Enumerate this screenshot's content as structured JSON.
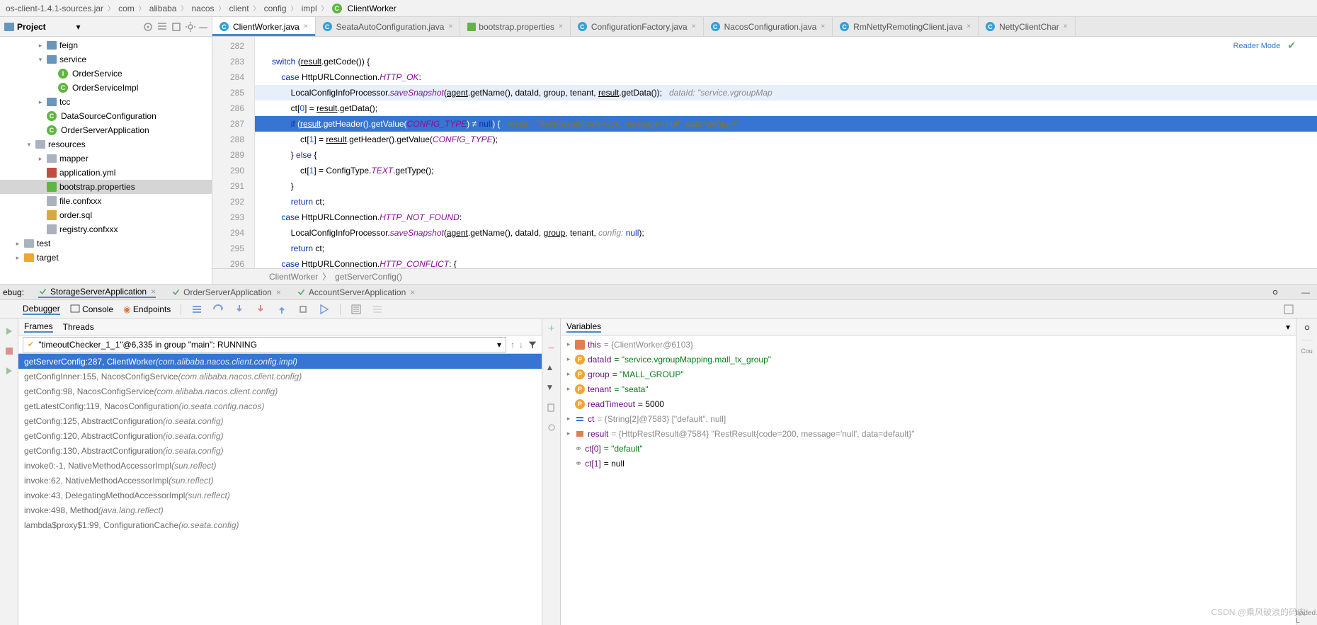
{
  "breadcrumb": [
    "os-client-1.4.1-sources.jar",
    "com",
    "alibaba",
    "nacos",
    "client",
    "config",
    "impl",
    "ClientWorker"
  ],
  "project": {
    "label": "Project",
    "tree": [
      {
        "indent": 3,
        "arrow": ">",
        "icon": "folder-blue",
        "label": "feign"
      },
      {
        "indent": 3,
        "arrow": "v",
        "icon": "folder-blue",
        "label": "service"
      },
      {
        "indent": 4,
        "arrow": "",
        "icon": "interface",
        "label": "OrderService"
      },
      {
        "indent": 4,
        "arrow": "",
        "icon": "class",
        "label": "OrderServiceImpl"
      },
      {
        "indent": 3,
        "arrow": ">",
        "icon": "folder-blue",
        "label": "tcc"
      },
      {
        "indent": 3,
        "arrow": "",
        "icon": "class",
        "label": "DataSourceConfiguration"
      },
      {
        "indent": 3,
        "arrow": "",
        "icon": "class",
        "label": "OrderServerApplication"
      },
      {
        "indent": 2,
        "arrow": "v",
        "icon": "folder-res",
        "label": "resources"
      },
      {
        "indent": 3,
        "arrow": ">",
        "icon": "folder",
        "label": "mapper"
      },
      {
        "indent": 3,
        "arrow": "",
        "icon": "yml",
        "label": "application.yml"
      },
      {
        "indent": 3,
        "arrow": "",
        "icon": "prop",
        "label": "bootstrap.properties",
        "sel": true
      },
      {
        "indent": 3,
        "arrow": "",
        "icon": "txt",
        "label": "file.confxxx"
      },
      {
        "indent": 3,
        "arrow": "",
        "icon": "sql",
        "label": "order.sql"
      },
      {
        "indent": 3,
        "arrow": "",
        "icon": "txt",
        "label": "registry.confxxx"
      },
      {
        "indent": 1,
        "arrow": ">",
        "icon": "folder",
        "label": "test"
      },
      {
        "indent": 1,
        "arrow": ">",
        "icon": "folder-orange",
        "label": "target"
      }
    ]
  },
  "editor": {
    "tabs": [
      {
        "label": "ClientWorker.java",
        "active": true
      },
      {
        "label": "SeataAutoConfiguration.java"
      },
      {
        "label": "bootstrap.properties",
        "icon": "prop"
      },
      {
        "label": "ConfigurationFactory.java"
      },
      {
        "label": "NacosConfiguration.java"
      },
      {
        "label": "RmNettyRemotingClient.java"
      },
      {
        "label": "NettyClientChar"
      }
    ],
    "reader_mode": "Reader Mode",
    "sub_crumb": [
      "ClientWorker",
      "getServerConfig()"
    ],
    "startLine": 282
  },
  "debug": {
    "label": "ebug:",
    "runs": [
      {
        "label": "StorageServerApplication",
        "sel": true
      },
      {
        "label": "OrderServerApplication"
      },
      {
        "label": "AccountServerApplication"
      }
    ],
    "sub_tabs": [
      "Debugger",
      "Console",
      "Endpoints"
    ],
    "pane_tabs": [
      "Frames",
      "Threads"
    ],
    "thread": "\"timeoutChecker_1_1\"@6,335 in group \"main\": RUNNING",
    "frames": [
      {
        "m": "getServerConfig:287, ClientWorker ",
        "p": "(com.alibaba.nacos.client.config.impl)",
        "sel": true
      },
      {
        "m": "getConfigInner:155, NacosConfigService ",
        "p": "(com.alibaba.nacos.client.config)"
      },
      {
        "m": "getConfig:98, NacosConfigService ",
        "p": "(com.alibaba.nacos.client.config)"
      },
      {
        "m": "getLatestConfig:119, NacosConfiguration ",
        "p": "(io.seata.config.nacos)"
      },
      {
        "m": "getConfig:125, AbstractConfiguration ",
        "p": "(io.seata.config)"
      },
      {
        "m": "getConfig:120, AbstractConfiguration ",
        "p": "(io.seata.config)"
      },
      {
        "m": "getConfig:130, AbstractConfiguration ",
        "p": "(io.seata.config)"
      },
      {
        "m": "invoke0:-1, NativeMethodAccessorImpl ",
        "p": "(sun.reflect)"
      },
      {
        "m": "invoke:62, NativeMethodAccessorImpl ",
        "p": "(sun.reflect)"
      },
      {
        "m": "invoke:43, DelegatingMethodAccessorImpl ",
        "p": "(sun.reflect)"
      },
      {
        "m": "invoke:498, Method ",
        "p": "(java.lang.reflect)"
      },
      {
        "m": "lambda$proxy$1:99, ConfigurationCache ",
        "p": "(io.seata.config)"
      }
    ],
    "vars_title": "Variables",
    "vars": [
      {
        "arrow": ">",
        "badge": "this",
        "name": "this",
        "val": " = {ClientWorker@6103}",
        "vclass": "varg"
      },
      {
        "arrow": ">",
        "badge": "p",
        "name": "dataId",
        "val": " = \"service.vgroupMapping.mall_tx_group\"",
        "vclass": "varv"
      },
      {
        "arrow": ">",
        "badge": "p",
        "name": "group",
        "val": " = \"MALL_GROUP\"",
        "vclass": "varv"
      },
      {
        "arrow": ">",
        "badge": "p",
        "name": "tenant",
        "val": " = \"seata\"",
        "vclass": "varv"
      },
      {
        "arrow": "",
        "badge": "p",
        "name": "readTimeout",
        "val": " = 5000",
        "vclass": ""
      },
      {
        "arrow": ">",
        "badge": "arr",
        "name": "ct",
        "val": " = {String[2]@7583} [\"default\", null]",
        "vclass": "varg"
      },
      {
        "arrow": ">",
        "badge": "obj",
        "name": "result",
        "val": " = {HttpRestResult@7584} \"RestResult{code=200, message='null', data=default}\"",
        "vclass": "varg"
      },
      {
        "arrow": "",
        "badge": "link",
        "name": "ct[0]",
        "val": " = \"default\"",
        "vclass": "varv"
      },
      {
        "arrow": "",
        "badge": "link",
        "name": "ct[1]",
        "val": " = null",
        "vclass": ""
      }
    ],
    "right_info": "baded. L",
    "right_cou": "Cou"
  },
  "watermark": "CSDN @乘风破浪的码农"
}
